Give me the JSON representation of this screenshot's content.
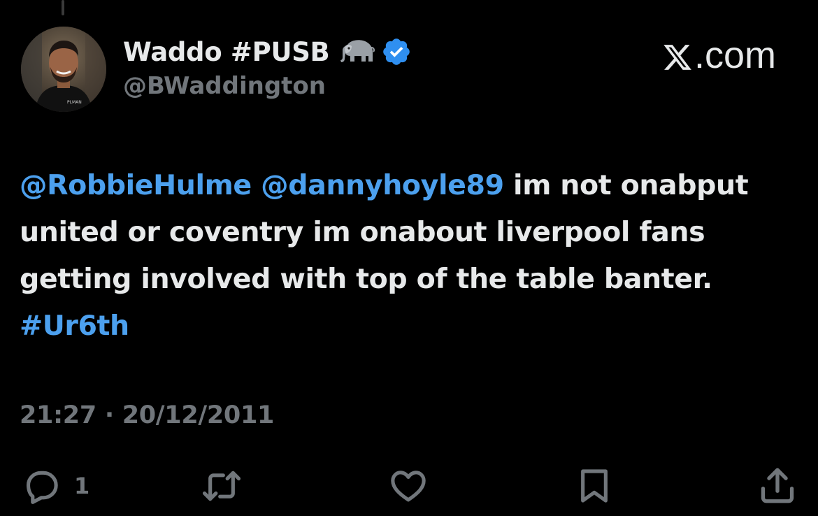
{
  "author": {
    "display_name": "Waddo #PUSB",
    "emoji_icon": "elephant-icon",
    "verified_icon": "verified-badge-icon",
    "verified_color": "#2f8ff0",
    "handle": "@BWaddington"
  },
  "brand": {
    "logo_icon": "x-logo-icon",
    "suffix": ".com"
  },
  "tweet": {
    "mention_1": "@RobbieHulme",
    "mention_2": "@dannyhoyle89",
    "text_1": " im not onabput united or coventry im onabout liverpool fans getting involved with top of the table banter.",
    "hashtag": "#Ur6th",
    "link_color": "#4ca0ee"
  },
  "meta": {
    "time": "21:27",
    "separator": "·",
    "date": "20/12/2011"
  },
  "actions": {
    "reply_icon": "reply-icon",
    "reply_count": "1",
    "retweet_icon": "retweet-icon",
    "like_icon": "heart-icon",
    "bookmark_icon": "bookmark-icon",
    "share_icon": "share-icon"
  }
}
